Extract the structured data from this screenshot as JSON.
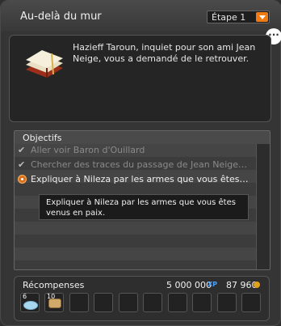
{
  "quest": {
    "title": "Au-delà du mur",
    "step_label": "Étape 1",
    "description": "Hazieff Taroun, inquiet pour son ami Jean Neige, vous a demandé de le retrouver."
  },
  "objectives": {
    "header": "Objectifs",
    "items": [
      {
        "label": "Aller voir Baron d'Ouillard",
        "status": "done"
      },
      {
        "label": "Chercher des traces du passage de Jean Neige d...",
        "status": "done"
      },
      {
        "label": "Expliquer à Nileza par les armes que vous êtes ve...",
        "status": "active"
      }
    ],
    "tooltip": "Expliquer à Nileza par les armes que vous êtes venus en paix."
  },
  "rewards": {
    "label": "Récompenses",
    "kamas": "5 000 000",
    "xp_icon_text": "XP",
    "xp": "87 960",
    "items": [
      {
        "count": "6",
        "icon": "ice-item-icon"
      },
      {
        "count": "10",
        "icon": "bread-item-icon"
      }
    ]
  },
  "colors": {
    "accent": "#f07b12",
    "background": "#353535"
  }
}
